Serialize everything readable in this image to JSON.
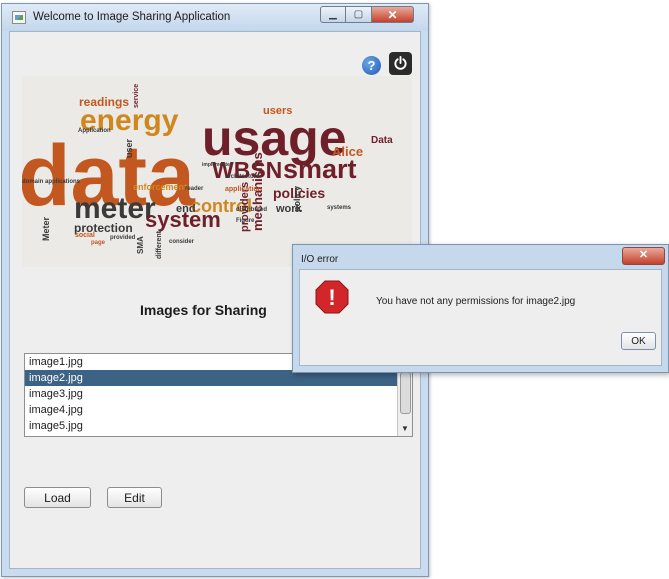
{
  "main_window": {
    "title": "Welcome to Image Sharing Application",
    "controls": {
      "minimize": "▁",
      "maximize": "▢",
      "close": "✕"
    },
    "toolbar": {
      "help_glyph": "?"
    },
    "word_cloud": {
      "words": [
        {
          "text": "data",
          "color": "#c2571f"
        },
        {
          "text": "usage",
          "color": "#6e1f2a"
        },
        {
          "text": "energy",
          "color": "#d0871e"
        },
        {
          "text": "meter",
          "color": "#3a3a3a"
        },
        {
          "text": "WBSN",
          "color": "#6e1f2a"
        },
        {
          "text": "smart",
          "color": "#6e1f2a"
        },
        {
          "text": "system",
          "color": "#6e1f2a"
        },
        {
          "text": "control",
          "color": "#d0871e"
        },
        {
          "text": "policies",
          "color": "#6e1f2a"
        },
        {
          "text": "protection",
          "color": "#3a3a3a"
        },
        {
          "text": "readings",
          "color": "#c2571f"
        },
        {
          "text": "users",
          "color": "#c2571f"
        },
        {
          "text": "Alice",
          "color": "#c2571f"
        },
        {
          "text": "Data",
          "color": "#6e1f2a"
        },
        {
          "text": "mechanisms",
          "color": "#6e1f2a"
        },
        {
          "text": "providers",
          "color": "#6e1f2a"
        },
        {
          "text": "enforcement",
          "color": "#d0871e"
        },
        {
          "text": "work",
          "color": "#3a3a3a"
        },
        {
          "text": "end",
          "color": "#3a3a3a"
        },
        {
          "text": "user",
          "color": "#3a3a3a"
        },
        {
          "text": "policy",
          "color": "#3a3a3a"
        },
        {
          "text": "service",
          "color": "#6e1f2a"
        },
        {
          "text": "SMA",
          "color": "#3a3a3a"
        },
        {
          "text": "Meter",
          "color": "#3a3a3a"
        },
        {
          "text": "application",
          "color": "#c2571f"
        },
        {
          "text": "architecture",
          "color": "#3a3a3a"
        },
        {
          "text": "domain applications",
          "color": "#3a3a3a"
        },
        {
          "text": "social",
          "color": "#c2571f"
        },
        {
          "text": "different",
          "color": "#3a3a3a"
        },
        {
          "text": "consider",
          "color": "#3a3a3a"
        },
        {
          "text": "Figure",
          "color": "#3a3a3a"
        },
        {
          "text": "systems",
          "color": "#3a3a3a"
        },
        {
          "text": "distributed",
          "color": "#3a3a3a"
        },
        {
          "text": "page",
          "color": "#c2571f"
        },
        {
          "text": "provided",
          "color": "#3a3a3a"
        },
        {
          "text": "Application",
          "color": "#3a3a3a"
        },
        {
          "text": "reader",
          "color": "#3a3a3a"
        },
        {
          "text": "implemented",
          "color": "#3a3a3a"
        }
      ]
    },
    "section_title": "Images for Sharing",
    "image_list": {
      "items": [
        "image1.jpg",
        "image2.jpg",
        "image3.jpg",
        "image4.jpg",
        "image5.jpg"
      ],
      "selected": "image2.jpg",
      "scroll_down_glyph": "▼"
    },
    "buttons": {
      "load": "Load",
      "edit": "Edit"
    }
  },
  "error_dialog": {
    "title": "I/O error",
    "message": "You have not any permissions for image2.jpg",
    "ok": "OK",
    "close_glyph": "✕",
    "error_glyph": "!"
  },
  "colors": {
    "window_frame": "#c9dcef",
    "client_bg": "#eeeeee",
    "selection": "#3c6284",
    "close_button": "#c4412c",
    "error_icon": "#d3262a"
  }
}
